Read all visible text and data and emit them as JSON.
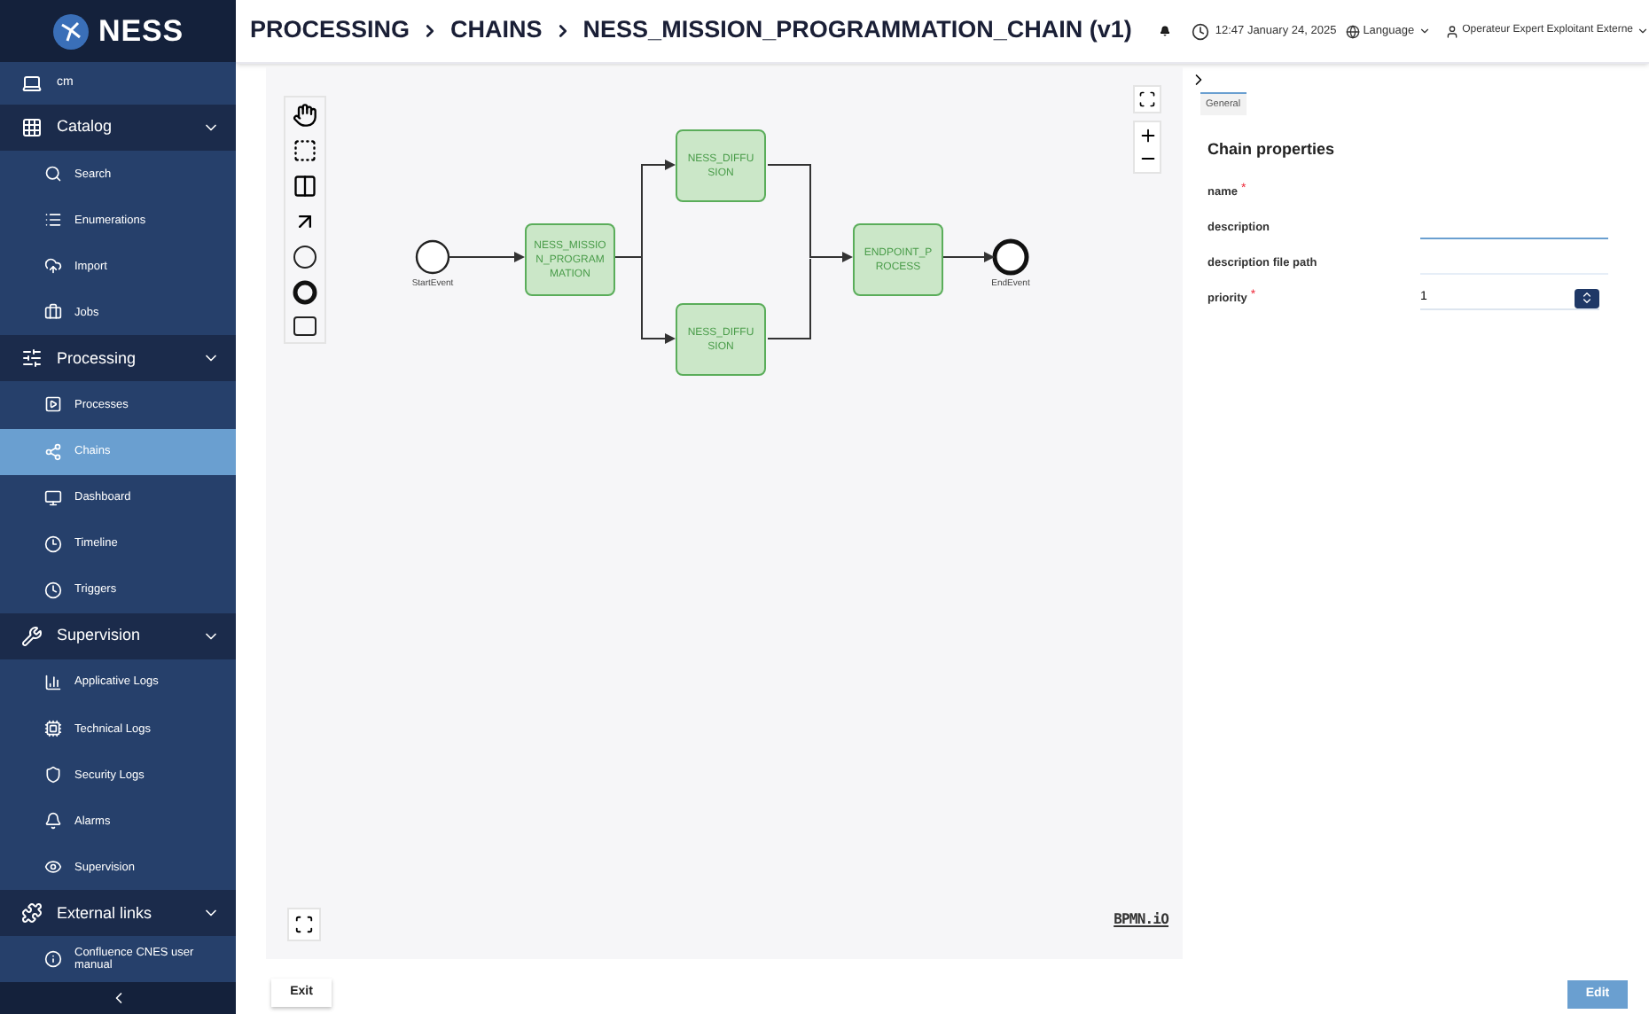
{
  "logo": {
    "text": "NESS"
  },
  "sidebar": {
    "items": [
      {
        "kind": "link",
        "label": "cm",
        "selected": false
      },
      {
        "kind": "section",
        "label": "Catalog",
        "expanded": true,
        "children": [
          {
            "label": "Search",
            "selected": false
          },
          {
            "label": "Enumerations",
            "selected": false
          },
          {
            "label": "Import",
            "selected": false
          },
          {
            "label": "Jobs",
            "selected": false
          }
        ]
      },
      {
        "kind": "section",
        "label": "Processing",
        "expanded": true,
        "children": [
          {
            "label": "Processes",
            "selected": false
          },
          {
            "label": "Chains",
            "selected": true
          },
          {
            "label": "Dashboard",
            "selected": false
          },
          {
            "label": "Timeline",
            "selected": false
          },
          {
            "label": "Triggers",
            "selected": false
          }
        ]
      },
      {
        "kind": "section",
        "label": "Supervision",
        "expanded": true,
        "children": [
          {
            "label": "Applicative Logs",
            "selected": false
          },
          {
            "label": "Technical Logs",
            "selected": false
          },
          {
            "label": "Security Logs",
            "selected": false
          },
          {
            "label": "Alarms",
            "selected": false
          },
          {
            "label": "Supervision",
            "selected": false
          }
        ]
      },
      {
        "kind": "section",
        "label": "External links",
        "expanded": true,
        "children": [
          {
            "label": "Confluence CNES user manual",
            "selected": false
          }
        ]
      }
    ]
  },
  "breadcrumb": [
    "PROCESSING",
    "CHAINS",
    "NESS_MISSION_PROGRAMMATION_CHAIN (v1)"
  ],
  "header": {
    "datetime": "12:47 January 24, 2025",
    "language": "Language",
    "user": "Operateur Expert Exploitant Externe"
  },
  "diagram": {
    "start": {
      "label": "StartEvent"
    },
    "end": {
      "label": "EndEvent"
    },
    "tasks": [
      {
        "label": "NESS_MISSION_PROGRAMMATION"
      },
      {
        "label": "NESS_DIFFUSION"
      },
      {
        "label": "NESS_DIFFUSION"
      },
      {
        "label": "ENDPOINT_PROCESS"
      }
    ],
    "watermark_link": "BPMN.iO"
  },
  "panel": {
    "tabs": [
      {
        "label": "General",
        "selected": true
      }
    ],
    "title": "Chain properties",
    "fields": [
      {
        "kind": "none",
        "label": "name",
        "required_mark": "*"
      },
      {
        "kind": "text",
        "label": "description",
        "focused": true
      },
      {
        "kind": "text",
        "label": "description file path",
        "focused": false
      },
      {
        "kind": "number",
        "label": "priority",
        "required_mark": "*",
        "value": "1",
        "focused": false
      }
    ]
  },
  "buttons": {
    "exit": "Exit",
    "edit": "Edit"
  }
}
